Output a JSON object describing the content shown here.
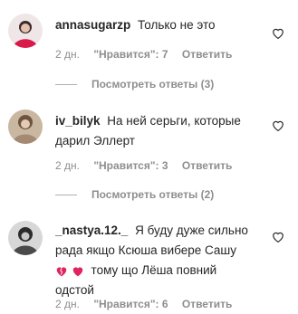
{
  "comments": [
    {
      "username": "annasugarzp",
      "text": "Только не это",
      "age": "2 дн.",
      "likes": "\"Нравится\": 7",
      "reply": "Ответить",
      "view_replies": "Посмотреть ответы (3)"
    },
    {
      "username": "iv_bilyk",
      "text_line1": "На ней серьги, которые",
      "text_line2": "дарил Эллерт",
      "age": "2 дн.",
      "likes": "\"Нравится\": 3",
      "reply": "Ответить",
      "view_replies": "Посмотреть ответы (2)"
    },
    {
      "username": "_nastya.12._",
      "text_line1": "Я буду дуже сильно",
      "text_line2": "рада якщо Ксюша вибере Сашу",
      "text_line3": "тому що Лёша повний",
      "text_line4": "одстой",
      "age": "2 дн.",
      "likes": "\"Нравится\": 6",
      "reply": "Ответить"
    }
  ],
  "icons": {
    "like": "heart-outline-icon",
    "emoji_broken": "broken-heart-emoji",
    "emoji_heart": "red-heart-emoji"
  },
  "colors": {
    "text": "#262626",
    "secondary": "#8e8e8e",
    "emoji_red": "#e0245e"
  }
}
